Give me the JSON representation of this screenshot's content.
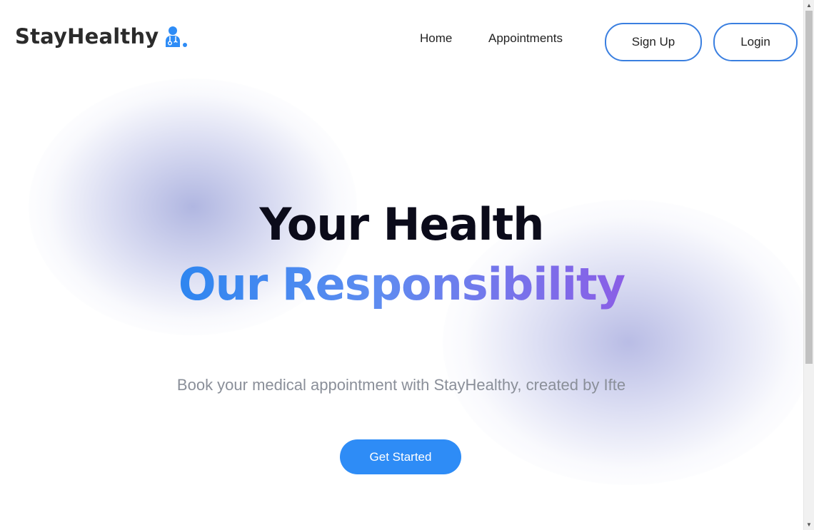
{
  "brand": {
    "name": "StayHealthy",
    "icon": "doctor-icon",
    "icon_color": "#2e8cf6"
  },
  "nav": {
    "links": [
      {
        "label": "Home"
      },
      {
        "label": "Appointments"
      }
    ],
    "signup_label": "Sign Up",
    "login_label": "Login"
  },
  "hero": {
    "title_line1": "Your Health",
    "title_line2": "Our Responsibility",
    "subtitle": "Book your medical appointment with StayHealthy, created by Ifte",
    "cta_label": "Get Started"
  },
  "colors": {
    "accent": "#2e8cf6",
    "outline_border": "#3a7fe0",
    "gradient_start": "#2e86f0",
    "gradient_end": "#8a5ee6",
    "blob": "#969ed7"
  }
}
